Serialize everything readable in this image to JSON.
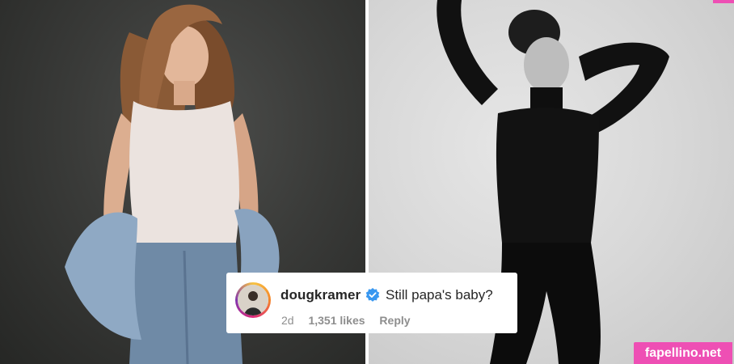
{
  "photos": {
    "left_desc_icon": "person-photo-icon",
    "right_desc_icon": "person-photo-icon"
  },
  "comment": {
    "username": "dougkramer",
    "text": "Still papa's baby?",
    "age": "2d",
    "likes": "1,351 likes",
    "reply_label": "Reply",
    "verified_icon": "verified-badge-icon"
  },
  "watermark": "fapellino.net",
  "colors": {
    "verified": "#3897f0",
    "watermark_bg": "#ee4fb4",
    "meta_text": "#8e8e8e"
  }
}
